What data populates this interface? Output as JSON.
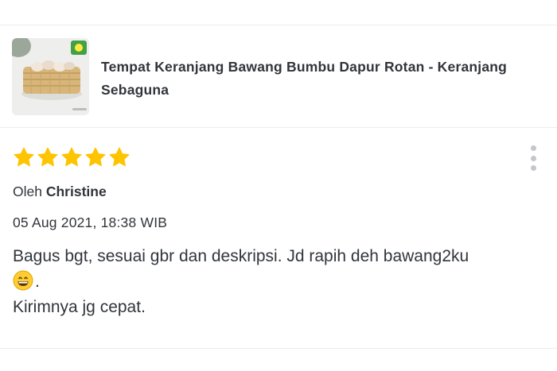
{
  "product": {
    "name": "Tempat Keranjang Bawang Bumbu Dapur Rotan - Keranjang Sebaguna",
    "thumbnail_icon": "rattan-basket-image"
  },
  "review": {
    "rating": 5,
    "rating_max": 5,
    "author_prefix": "Oleh",
    "author": "Christine",
    "date": "05 Aug 2021, 18:38 WIB",
    "text_line1": "Bagus bgt, sesuai gbr dan deskripsi. Jd rapih deh bawang2ku",
    "emoji": "grinning-face-emoji",
    "text_line1_end": ".",
    "text_line2": "Kirimnya jg cepat.",
    "menu_icon": "kebab-menu-icon"
  },
  "colors": {
    "star": "#ffc400",
    "text": "#31353b",
    "divider": "#ececec",
    "kebab": "#c3c6cc"
  }
}
